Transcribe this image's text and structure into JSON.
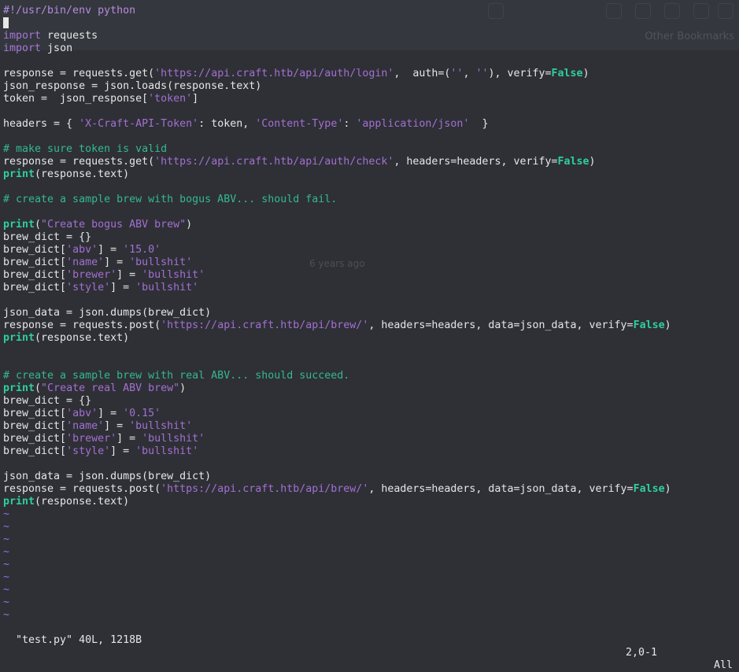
{
  "editor": {
    "lines": [
      [
        {
          "t": "#!/usr/bin/env python",
          "c": "sh"
        }
      ],
      [
        {
          "cursor": true
        }
      ],
      [
        {
          "t": "import",
          "c": "kw"
        },
        {
          "t": " requests"
        }
      ],
      [
        {
          "t": "import",
          "c": "kw"
        },
        {
          "t": " json"
        }
      ],
      [],
      [
        {
          "t": "response = requests.get("
        },
        {
          "t": "'https://api.craft.htb/api/auth/login'",
          "c": "str"
        },
        {
          "t": ",  auth=("
        },
        {
          "t": "''",
          "c": "str"
        },
        {
          "t": ", "
        },
        {
          "t": "''",
          "c": "str"
        },
        {
          "t": "), verify="
        },
        {
          "t": "False",
          "c": "bf"
        },
        {
          "t": ")"
        }
      ],
      [
        {
          "t": "json_response = json.loads(response.text)"
        }
      ],
      [
        {
          "t": "token =  json_response["
        },
        {
          "t": "'token'",
          "c": "str"
        },
        {
          "t": "]"
        }
      ],
      [],
      [
        {
          "t": "headers = { "
        },
        {
          "t": "'X-Craft-API-Token'",
          "c": "str"
        },
        {
          "t": ": token, "
        },
        {
          "t": "'Content-Type'",
          "c": "str"
        },
        {
          "t": ": "
        },
        {
          "t": "'application/json'",
          "c": "str"
        },
        {
          "t": "  }"
        }
      ],
      [],
      [
        {
          "t": "# make sure token is valid",
          "c": "cm"
        }
      ],
      [
        {
          "t": "response = requests.get("
        },
        {
          "t": "'https://api.craft.htb/api/auth/check'",
          "c": "str"
        },
        {
          "t": ", headers=headers, verify="
        },
        {
          "t": "False",
          "c": "bf"
        },
        {
          "t": ")"
        }
      ],
      [
        {
          "t": "print",
          "c": "bf"
        },
        {
          "t": "(response.text)"
        }
      ],
      [],
      [
        {
          "t": "# create a sample brew with bogus ABV... should fail.",
          "c": "cm"
        }
      ],
      [],
      [
        {
          "t": "print",
          "c": "bf"
        },
        {
          "t": "("
        },
        {
          "t": "\"Create bogus ABV brew\"",
          "c": "str"
        },
        {
          "t": ")"
        }
      ],
      [
        {
          "t": "brew_dict = {}"
        }
      ],
      [
        {
          "t": "brew_dict["
        },
        {
          "t": "'abv'",
          "c": "str"
        },
        {
          "t": "] = "
        },
        {
          "t": "'15.0'",
          "c": "str"
        }
      ],
      [
        {
          "t": "brew_dict["
        },
        {
          "t": "'name'",
          "c": "str"
        },
        {
          "t": "] = "
        },
        {
          "t": "'bullshit'",
          "c": "str"
        }
      ],
      [
        {
          "t": "brew_dict["
        },
        {
          "t": "'brewer'",
          "c": "str"
        },
        {
          "t": "] = "
        },
        {
          "t": "'bullshit'",
          "c": "str"
        }
      ],
      [
        {
          "t": "brew_dict["
        },
        {
          "t": "'style'",
          "c": "str"
        },
        {
          "t": "] = "
        },
        {
          "t": "'bullshit'",
          "c": "str"
        }
      ],
      [],
      [
        {
          "t": "json_data = json.dumps(brew_dict)"
        }
      ],
      [
        {
          "t": "response = requests.post("
        },
        {
          "t": "'https://api.craft.htb/api/brew/'",
          "c": "str"
        },
        {
          "t": ", headers=headers, data=json_data, verify="
        },
        {
          "t": "False",
          "c": "bf"
        },
        {
          "t": ")"
        }
      ],
      [
        {
          "t": "print",
          "c": "bf"
        },
        {
          "t": "(response.text)"
        }
      ],
      [],
      [],
      [
        {
          "t": "# create a sample brew with real ABV... should succeed.",
          "c": "cm"
        }
      ],
      [
        {
          "t": "print",
          "c": "bf"
        },
        {
          "t": "("
        },
        {
          "t": "\"Create real ABV brew\"",
          "c": "str"
        },
        {
          "t": ")"
        }
      ],
      [
        {
          "t": "brew_dict = {}"
        }
      ],
      [
        {
          "t": "brew_dict["
        },
        {
          "t": "'abv'",
          "c": "str"
        },
        {
          "t": "] = "
        },
        {
          "t": "'0.15'",
          "c": "str"
        }
      ],
      [
        {
          "t": "brew_dict["
        },
        {
          "t": "'name'",
          "c": "str"
        },
        {
          "t": "] = "
        },
        {
          "t": "'bullshit'",
          "c": "str"
        }
      ],
      [
        {
          "t": "brew_dict["
        },
        {
          "t": "'brewer'",
          "c": "str"
        },
        {
          "t": "] = "
        },
        {
          "t": "'bullshit'",
          "c": "str"
        }
      ],
      [
        {
          "t": "brew_dict["
        },
        {
          "t": "'style'",
          "c": "str"
        },
        {
          "t": "] = "
        },
        {
          "t": "'bullshit'",
          "c": "str"
        }
      ],
      [],
      [
        {
          "t": "json_data = json.dumps(brew_dict)"
        }
      ],
      [
        {
          "t": "response = requests.post("
        },
        {
          "t": "'https://api.craft.htb/api/brew/'",
          "c": "str"
        },
        {
          "t": ", headers=headers, data=json_data, verify="
        },
        {
          "t": "False",
          "c": "bf"
        },
        {
          "t": ")"
        }
      ],
      [
        {
          "t": "print",
          "c": "bf"
        },
        {
          "t": "(response.text)"
        }
      ],
      [
        {
          "t": "~",
          "c": "tilde"
        }
      ],
      [
        {
          "t": "~",
          "c": "tilde"
        }
      ],
      [
        {
          "t": "~",
          "c": "tilde"
        }
      ],
      [
        {
          "t": "~",
          "c": "tilde"
        }
      ],
      [
        {
          "t": "~",
          "c": "tilde"
        }
      ],
      [
        {
          "t": "~",
          "c": "tilde"
        }
      ],
      [
        {
          "t": "~",
          "c": "tilde"
        }
      ],
      [
        {
          "t": "~",
          "c": "tilde"
        }
      ],
      [
        {
          "t": "~",
          "c": "tilde"
        }
      ]
    ]
  },
  "background": {
    "bookmarks_label": "Other Bookmarks",
    "timestamp": "6 years ago"
  },
  "status_bar": {
    "file_info": "\"test.py\" 40L, 1218B",
    "cursor_position": "2,0-1",
    "scroll": "All"
  },
  "colors": {
    "background": "#2e3036",
    "keyword": "#a677d6",
    "builtin": "#2fcf9b",
    "string": "#a46fd1",
    "comment": "#35b88e",
    "tilde": "#7b7fe8"
  }
}
